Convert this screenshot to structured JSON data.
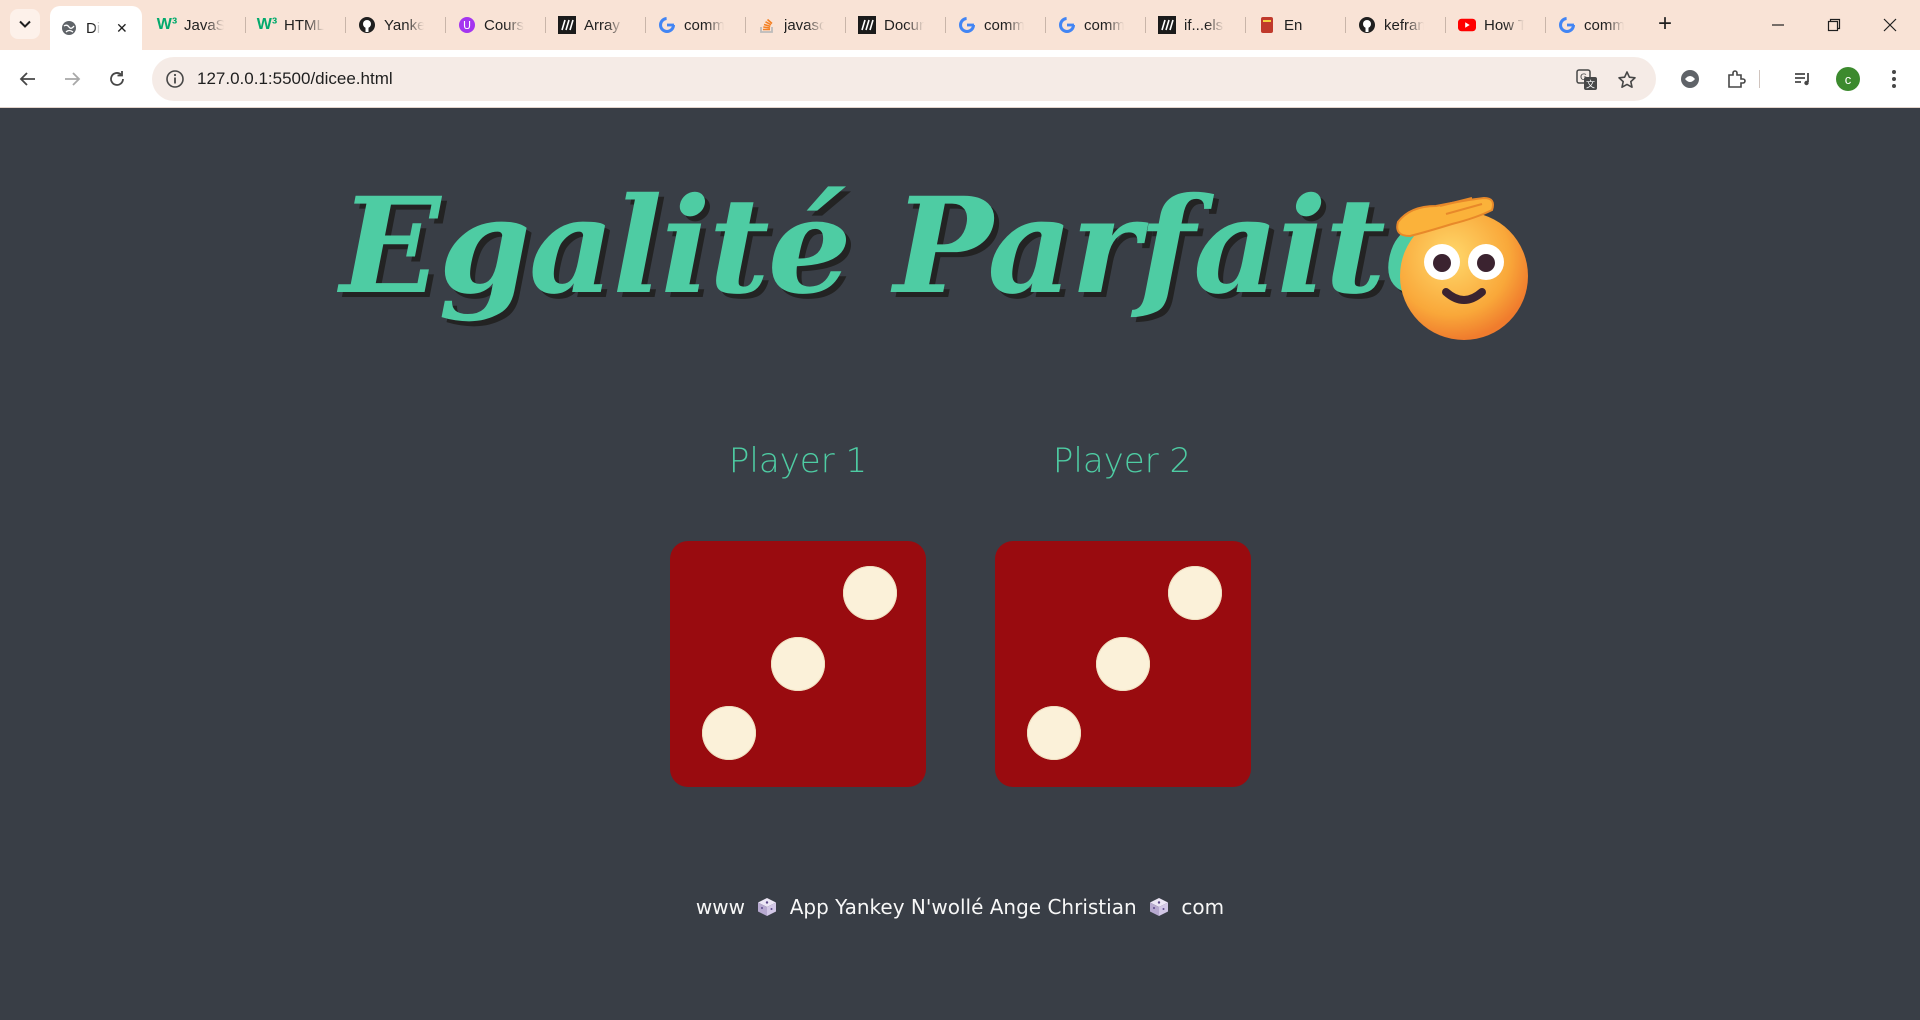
{
  "browser": {
    "tabs": [
      {
        "label": "Dicee",
        "favicon": "globe-icon",
        "active": true
      },
      {
        "label": "JavaScript",
        "favicon": "w3schools-icon"
      },
      {
        "label": "HTML",
        "favicon": "w3schools-icon"
      },
      {
        "label": "Yankey",
        "favicon": "github-icon"
      },
      {
        "label": "Course",
        "favicon": "udemy-icon"
      },
      {
        "label": "Array",
        "favicon": "mdn-icon"
      },
      {
        "label": "comm",
        "favicon": "google-icon"
      },
      {
        "label": "javascript",
        "favicon": "stackoverflow-icon"
      },
      {
        "label": "Document",
        "favicon": "mdn-icon"
      },
      {
        "label": "comm",
        "favicon": "google-icon"
      },
      {
        "label": "comm",
        "favicon": "google-icon"
      },
      {
        "label": "if...else",
        "favicon": "mdn-icon"
      },
      {
        "label": "En",
        "favicon": "book-icon"
      },
      {
        "label": "kefran",
        "favicon": "github-icon"
      },
      {
        "label": "How T",
        "favicon": "youtube-icon"
      },
      {
        "label": "comm",
        "favicon": "google-icon"
      }
    ],
    "address_bar": {
      "url": "127.0.0.1:5500/dicee.html"
    },
    "profile_initial": "c",
    "colors": {
      "tabstrip": "#f9e3d6",
      "toolbar": "#ffffff",
      "omnibox": "#f5ebe6"
    }
  },
  "page": {
    "title": "Egalité Parfaite",
    "title_emoji": "saluting-face-icon",
    "players": [
      {
        "label": "Player 1",
        "die_value": 3
      },
      {
        "label": "Player 2",
        "die_value": 3
      }
    ],
    "footer": {
      "prefix": "www",
      "text": "App Yankey N'wollé Ange Christian",
      "suffix": "com"
    },
    "colors": {
      "background": "#393e46",
      "accent": "#4ecca3",
      "die": "#990b0f",
      "pip": "#fbf1d9"
    }
  }
}
